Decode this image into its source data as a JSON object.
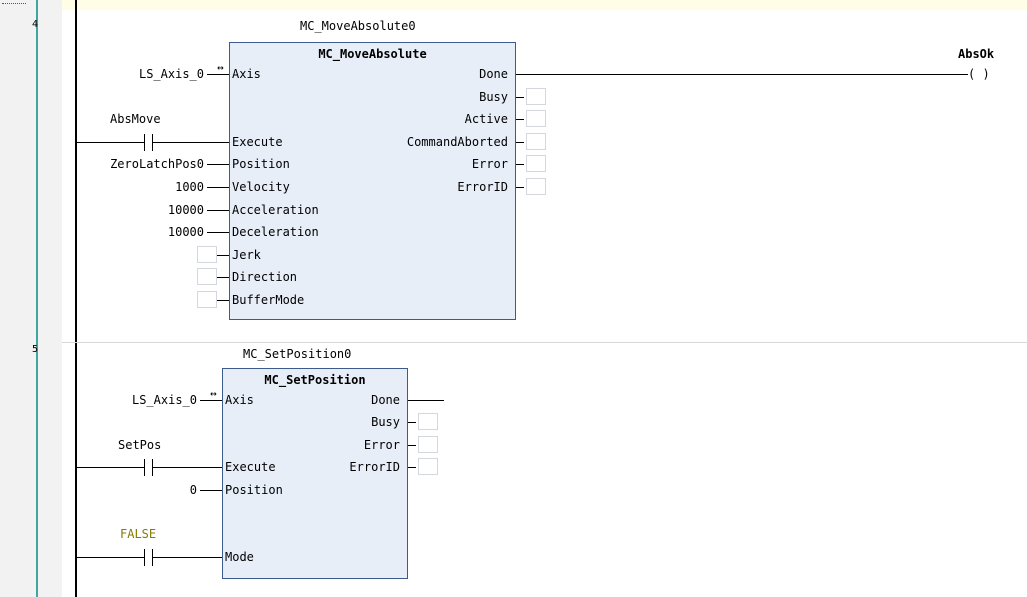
{
  "rungs": [
    {
      "number": "4",
      "instance": "MC_MoveAbsolute0",
      "block_type": "MC_MoveAbsolute",
      "inputs": [
        {
          "pin": "Axis",
          "variable": "LS_Axis_0",
          "inout": true
        },
        {
          "pin": "Execute",
          "contact": "AbsMove"
        },
        {
          "pin": "Position",
          "variable": "ZeroLatchPos0"
        },
        {
          "pin": "Velocity",
          "variable": "1000"
        },
        {
          "pin": "Acceleration",
          "variable": "10000"
        },
        {
          "pin": "Deceleration",
          "variable": "10000"
        },
        {
          "pin": "Jerk",
          "variable": ""
        },
        {
          "pin": "Direction",
          "variable": ""
        },
        {
          "pin": "BufferMode",
          "variable": ""
        }
      ],
      "outputs": [
        "Done",
        "Busy",
        "Active",
        "CommandAborted",
        "Error",
        "ErrorID"
      ],
      "coil": {
        "name": "AbsOk",
        "symbol": "( )"
      }
    },
    {
      "number": "5",
      "instance": "MC_SetPosition0",
      "block_type": "MC_SetPosition",
      "inputs": [
        {
          "pin": "Axis",
          "variable": "LS_Axis_0",
          "inout": true
        },
        {
          "pin": "Execute",
          "contact": "SetPos"
        },
        {
          "pin": "Position",
          "variable": "0"
        },
        {
          "pin": "Mode",
          "contact": "FALSE"
        }
      ],
      "outputs": [
        "Done",
        "Busy",
        "Error",
        "ErrorID"
      ]
    }
  ],
  "symbols": {
    "inout_arrow": "↔",
    "contact_glyph": "┤ ├"
  },
  "colors": {
    "block_fill": "#e8eef8",
    "block_border": "#3c5a8c",
    "false_text": "#8a7a00"
  }
}
